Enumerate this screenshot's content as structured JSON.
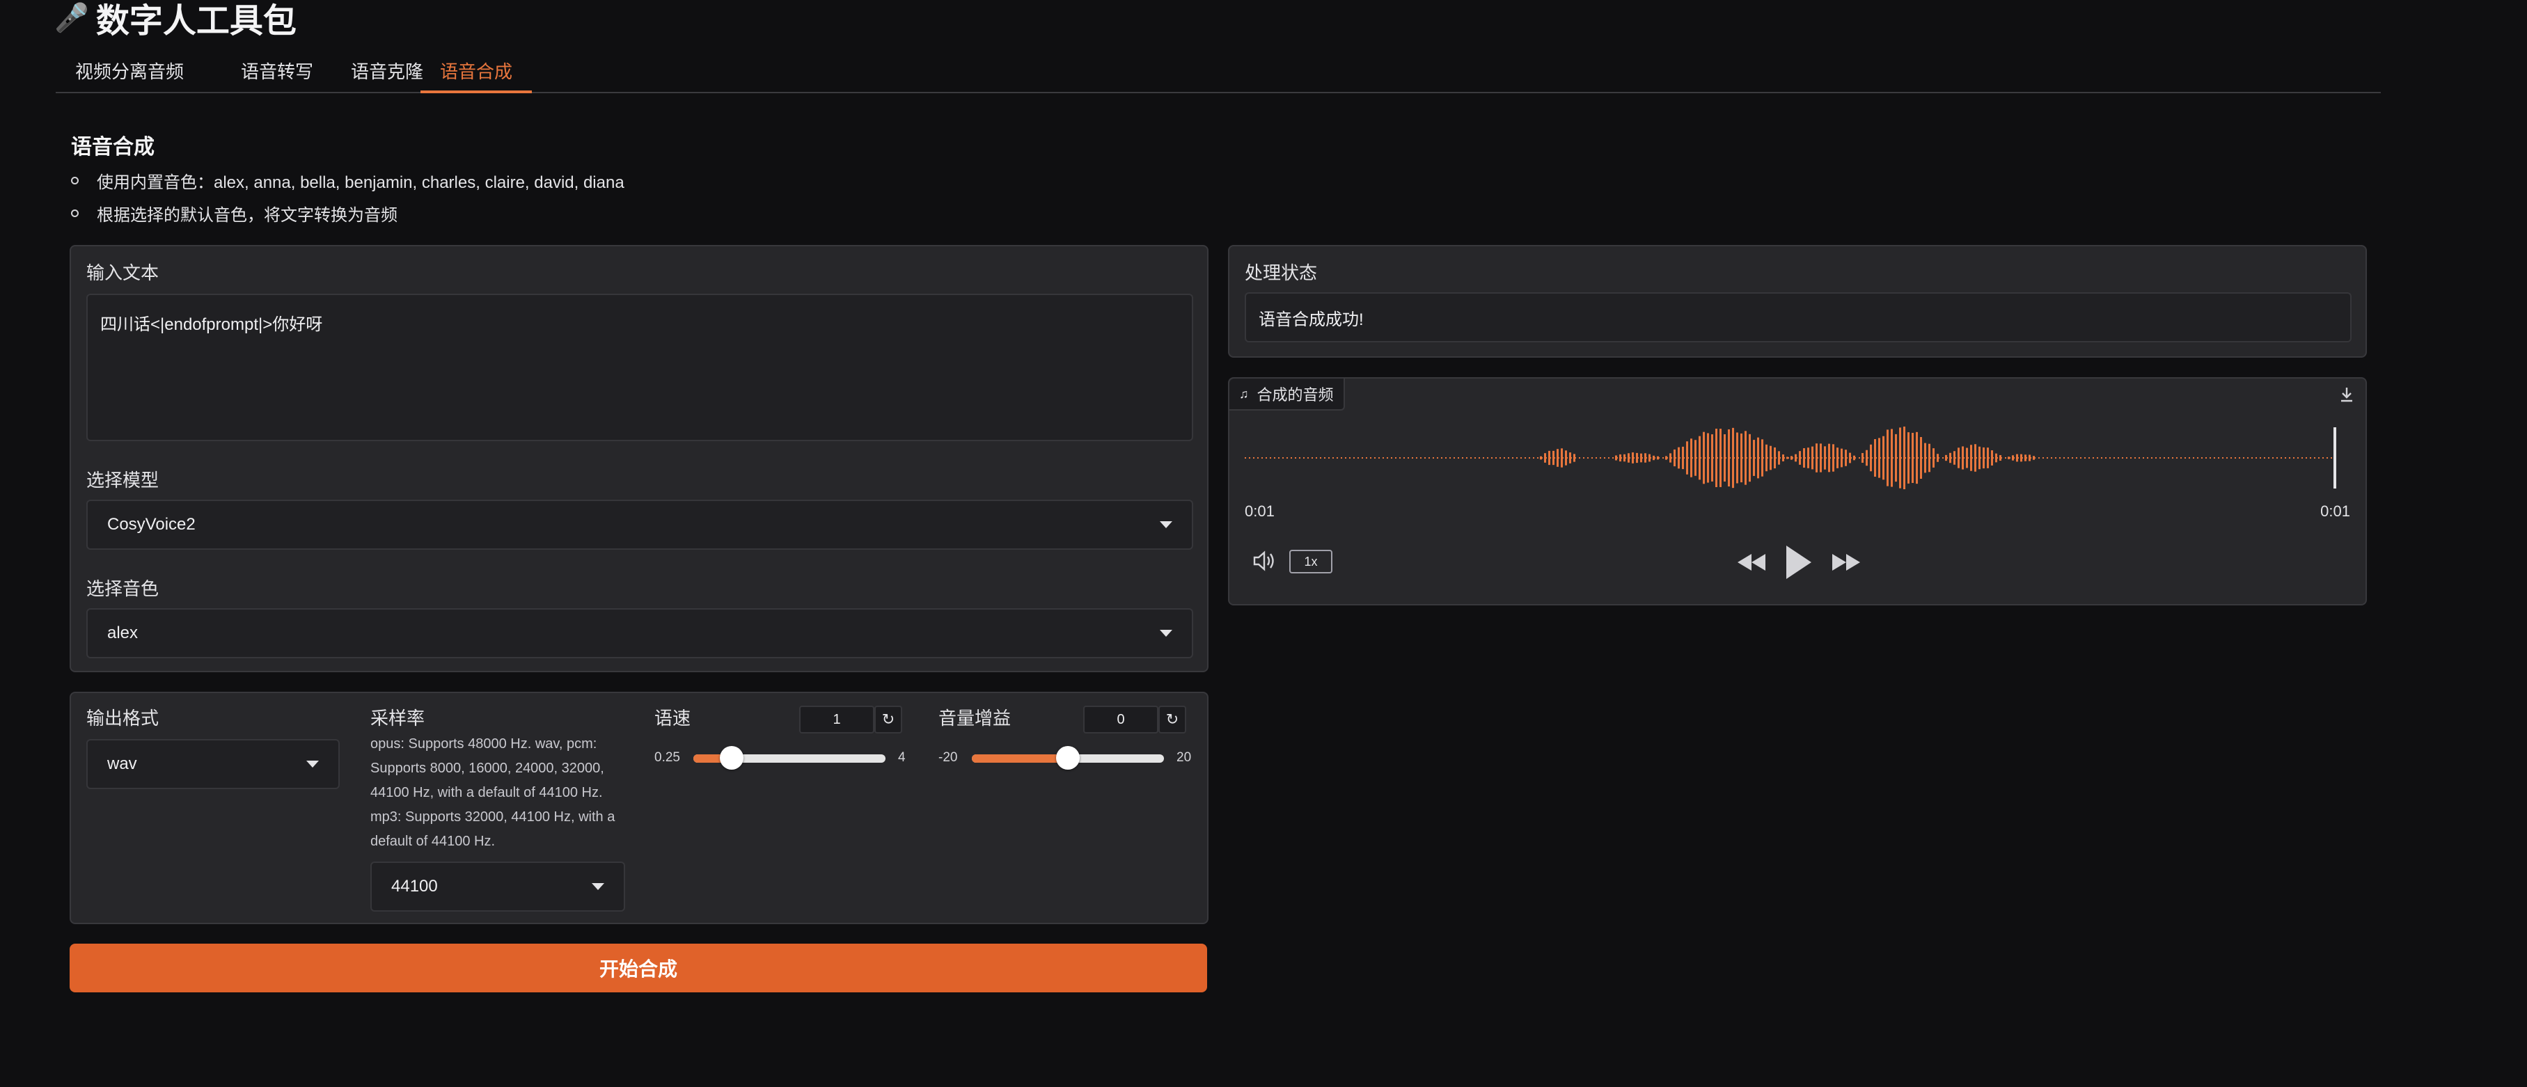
{
  "app": {
    "title": "数字人工具包",
    "icon": "microphone-icon"
  },
  "tabs": [
    {
      "label": "视频分离音频",
      "active": false
    },
    {
      "label": "语音转写",
      "active": false
    },
    {
      "label": "语音克隆",
      "active": false
    },
    {
      "label": "语音合成",
      "active": true
    }
  ],
  "intro": {
    "title": "语音合成",
    "bullets": [
      "使用内置音色：alex, anna, bella, benjamin, charles, claire, david, diana",
      "根据选择的默认音色，将文字转换为音频"
    ]
  },
  "input": {
    "text_label": "输入文本",
    "text_value": "四川话<|endofprompt|>你好呀",
    "model_label": "选择模型",
    "model_value": "CosyVoice2",
    "voice_label": "选择音色",
    "voice_value": "alex"
  },
  "settings": {
    "format_label": "输出格式",
    "format_value": "wav",
    "sample_rate_label": "采样率",
    "sample_rate_info": "opus: Supports 48000 Hz. wav, pcm: Supports 8000, 16000, 24000, 32000, 44100 Hz, with a default of 44100 Hz. mp3: Supports 32000, 44100 Hz, with a default of 44100 Hz.",
    "sample_rate_value": "44100",
    "speed": {
      "label": "语速",
      "value": "1",
      "min": "0.25",
      "max": "4",
      "fraction": 0.2
    },
    "gain": {
      "label": "音量增益",
      "value": "0",
      "min": "-20",
      "max": "20",
      "fraction": 0.5
    }
  },
  "start_button": "开始合成",
  "status": {
    "label": "处理状态",
    "value": "语音合成成功!"
  },
  "audio": {
    "label": "合成的音频",
    "current_time": "0:01",
    "duration": "0:01",
    "playback_rate": "1x"
  },
  "colors": {
    "accent": "#e8763d",
    "button": "#e0622a",
    "background": "#0f0f11",
    "panel": "#27272a"
  }
}
